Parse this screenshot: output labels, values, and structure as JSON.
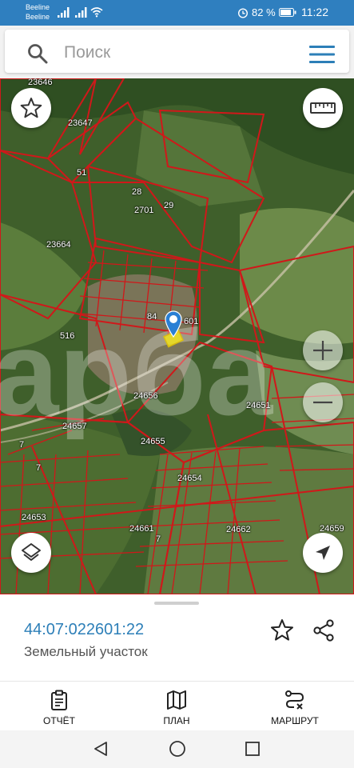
{
  "status_bar": {
    "carrier_1": "Beeline",
    "carrier_2": "Beeline",
    "battery": "82 %",
    "time": "11:22",
    "icons": [
      "signal-icon",
      "signal-icon",
      "wifi-icon",
      "alarm-icon",
      "battery-icon"
    ]
  },
  "search": {
    "placeholder": "Поиск",
    "icon": "search-icon",
    "menu_icon": "hamburger-menu-icon"
  },
  "map": {
    "parcel_color": "#d0181a",
    "labels": [
      "23646",
      "23647",
      "51",
      "28",
      "2701",
      "29",
      "23664",
      "84",
      "601",
      "516",
      "24656",
      "24651",
      "24657",
      "24655",
      "7",
      "7",
      "24654",
      "24653",
      "24661",
      "7",
      "24662",
      "24659"
    ],
    "controls": [
      "star-icon",
      "ruler-icon",
      "zoom-in-icon",
      "zoom-out-icon",
      "layers-icon",
      "locate-arrow-icon"
    ],
    "selected_marker": "location-pin-icon",
    "watermark": "арба"
  },
  "card": {
    "cadastral_number": "44:07:022601:22",
    "parcel_type": "Земельный участок",
    "accent_color": "#2d7fb8"
  },
  "bottom_nav": {
    "items": [
      {
        "label": "ОТЧЁТ",
        "icon": "report-clipboard-icon"
      },
      {
        "label": "ПЛАН",
        "icon": "map-plan-icon"
      },
      {
        "label": "МАРШРУТ",
        "icon": "route-icon"
      }
    ]
  },
  "system_nav": {
    "icons": [
      "back-triangle-icon",
      "home-circle-icon",
      "recents-square-icon"
    ]
  }
}
